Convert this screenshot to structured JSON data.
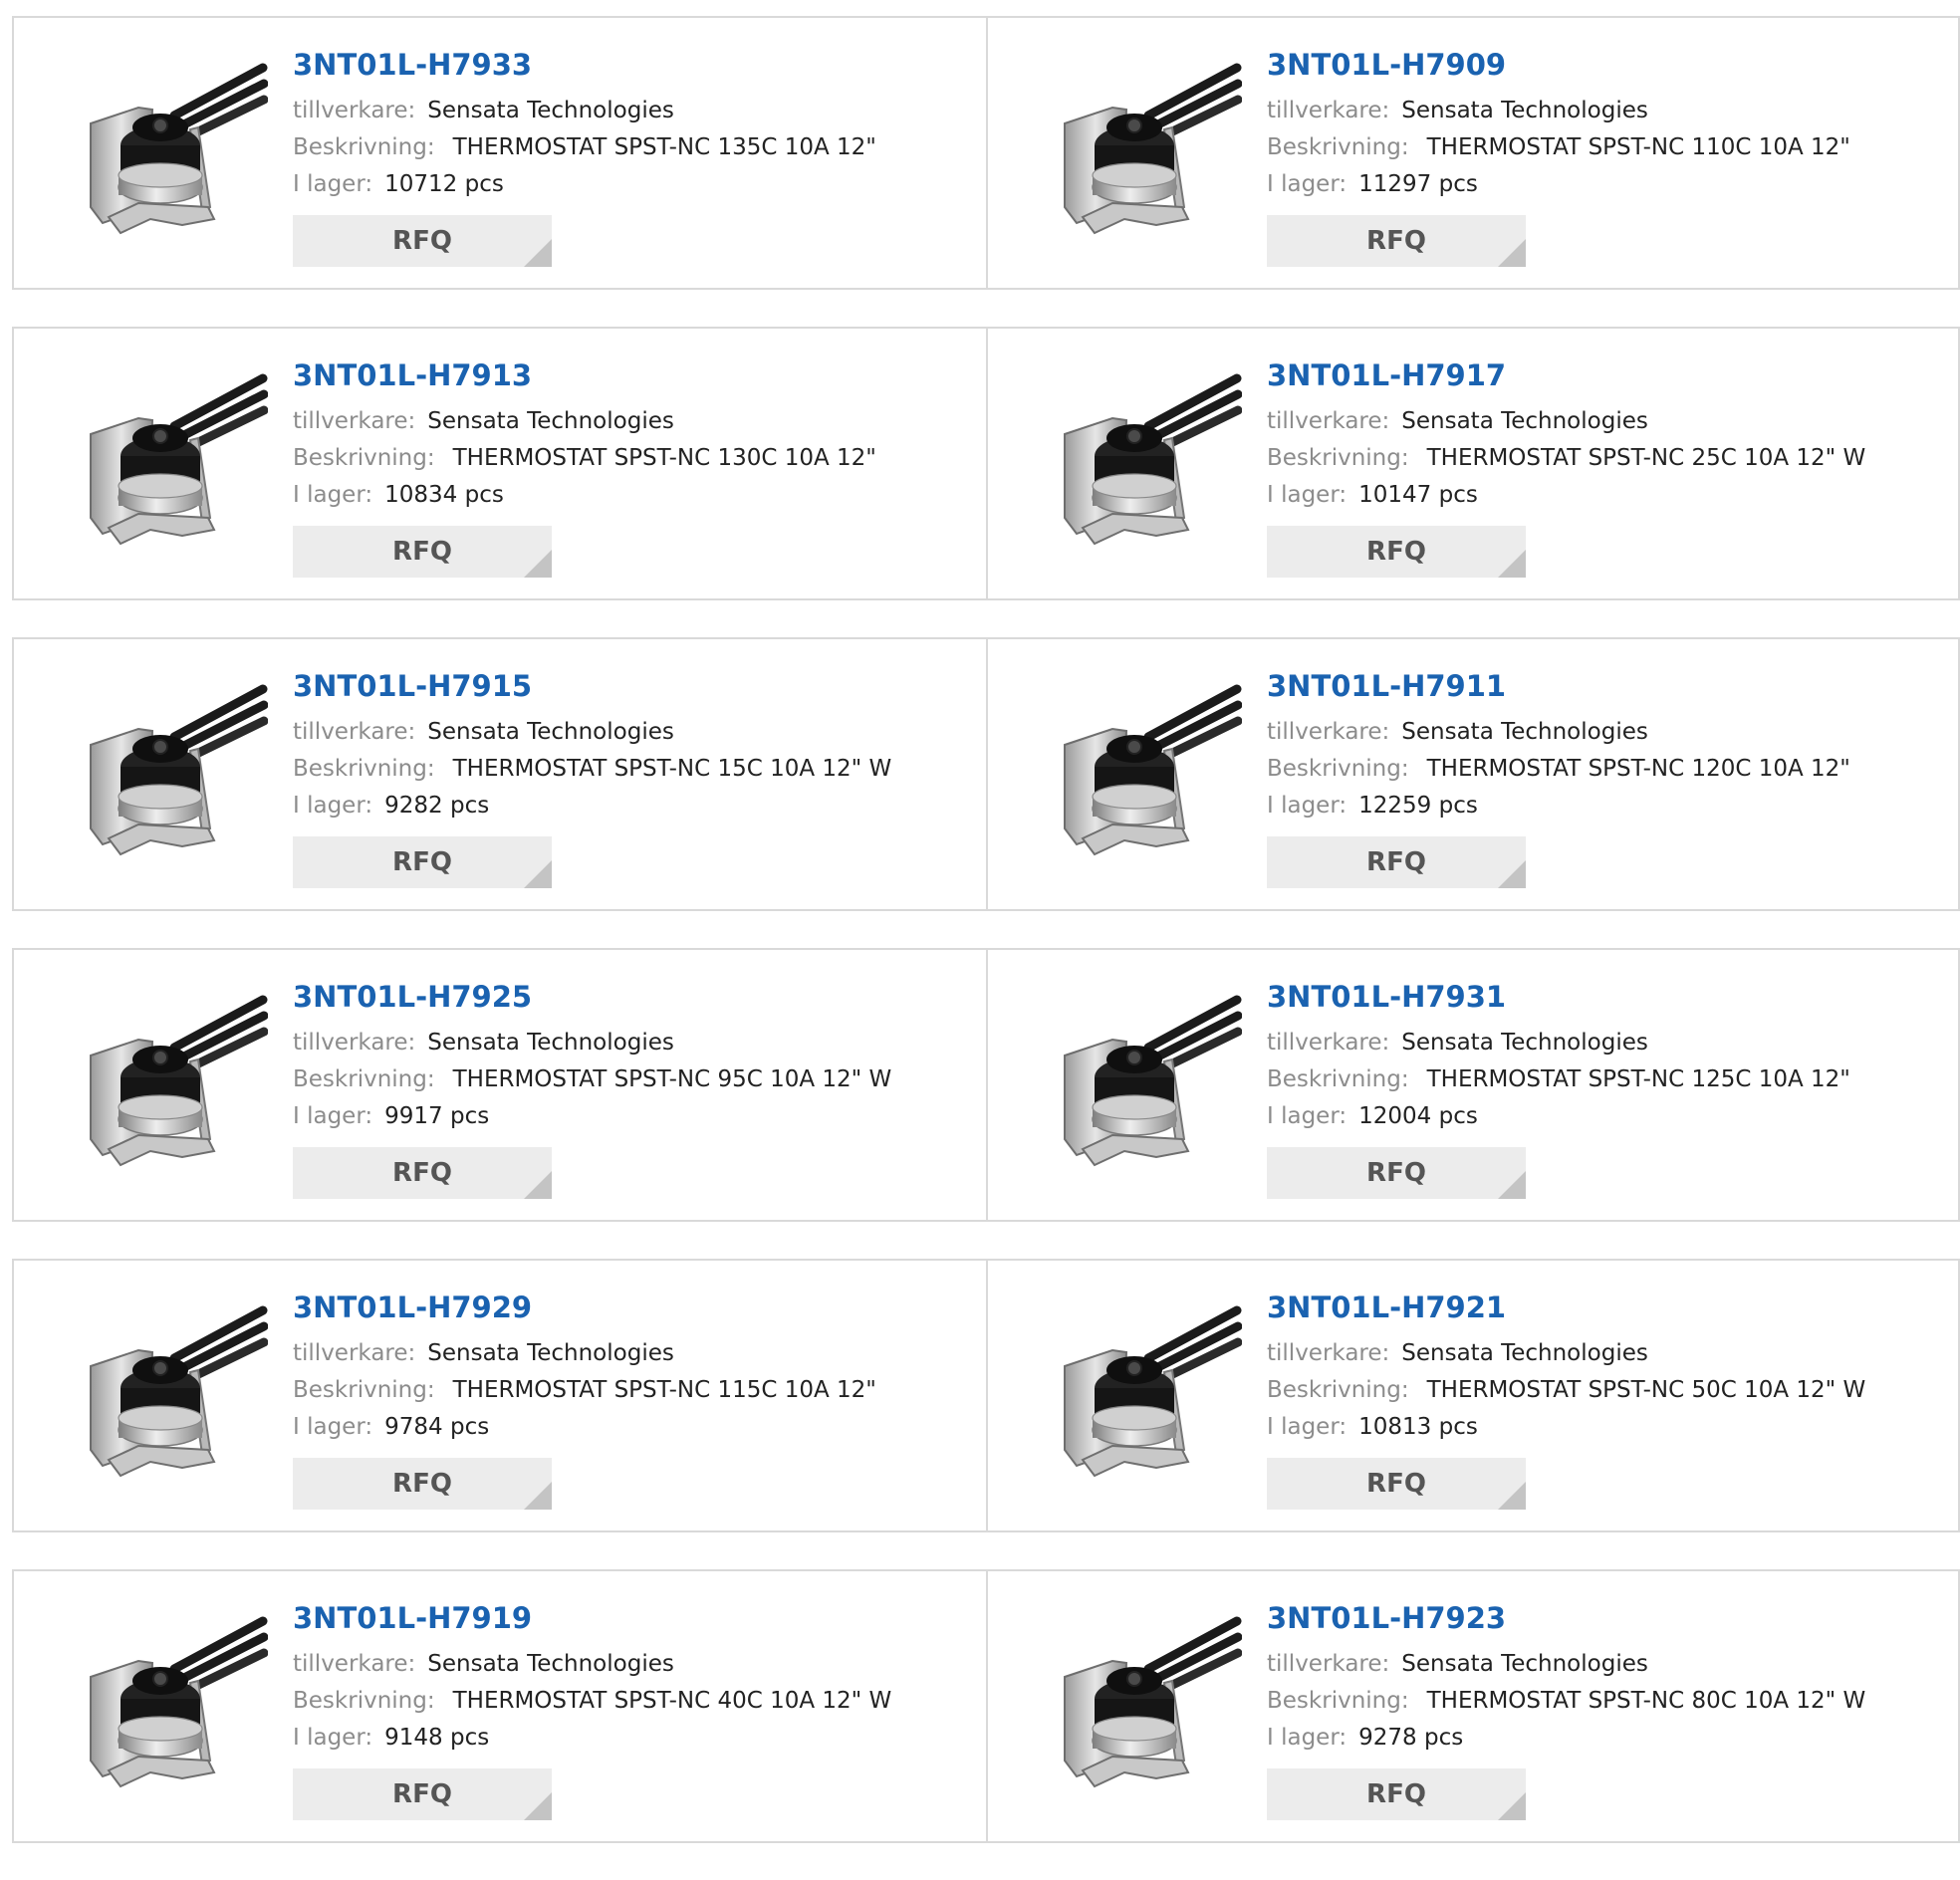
{
  "labels": {
    "manufacturer": "tillverkare:",
    "description": "Beskrivning:",
    "stock": "I lager:",
    "rfq": "RFQ",
    "image_icon": "thermostat-product-image"
  },
  "products": [
    {
      "part": "3NT01L-H7933",
      "manufacturer": "Sensata Technologies",
      "description": "THERMOSTAT SPST-NC 135C 10A 12\"",
      "stock": "10712 pcs"
    },
    {
      "part": "3NT01L-H7909",
      "manufacturer": "Sensata Technologies",
      "description": "THERMOSTAT SPST-NC 110C 10A 12\"",
      "stock": "11297 pcs"
    },
    {
      "part": "3NT01L-H7913",
      "manufacturer": "Sensata Technologies",
      "description": "THERMOSTAT SPST-NC 130C 10A 12\"",
      "stock": "10834 pcs"
    },
    {
      "part": "3NT01L-H7917",
      "manufacturer": "Sensata Technologies",
      "description": "THERMOSTAT SPST-NC 25C 10A 12\" W",
      "stock": "10147 pcs"
    },
    {
      "part": "3NT01L-H7915",
      "manufacturer": "Sensata Technologies",
      "description": "THERMOSTAT SPST-NC 15C 10A 12\" W",
      "stock": "9282 pcs"
    },
    {
      "part": "3NT01L-H7911",
      "manufacturer": "Sensata Technologies",
      "description": "THERMOSTAT SPST-NC 120C 10A 12\"",
      "stock": "12259 pcs"
    },
    {
      "part": "3NT01L-H7925",
      "manufacturer": "Sensata Technologies",
      "description": "THERMOSTAT SPST-NC 95C 10A 12\" W",
      "stock": "9917 pcs"
    },
    {
      "part": "3NT01L-H7931",
      "manufacturer": "Sensata Technologies",
      "description": "THERMOSTAT SPST-NC 125C 10A 12\"",
      "stock": "12004 pcs"
    },
    {
      "part": "3NT01L-H7929",
      "manufacturer": "Sensata Technologies",
      "description": "THERMOSTAT SPST-NC 115C 10A 12\"",
      "stock": "9784 pcs"
    },
    {
      "part": "3NT01L-H7921",
      "manufacturer": "Sensata Technologies",
      "description": "THERMOSTAT SPST-NC 50C 10A 12\" W",
      "stock": "10813 pcs"
    },
    {
      "part": "3NT01L-H7919",
      "manufacturer": "Sensata Technologies",
      "description": "THERMOSTAT SPST-NC 40C 10A 12\" W",
      "stock": "9148 pcs"
    },
    {
      "part": "3NT01L-H7923",
      "manufacturer": "Sensata Technologies",
      "description": "THERMOSTAT SPST-NC 80C 10A 12\" W",
      "stock": "9278 pcs"
    }
  ]
}
